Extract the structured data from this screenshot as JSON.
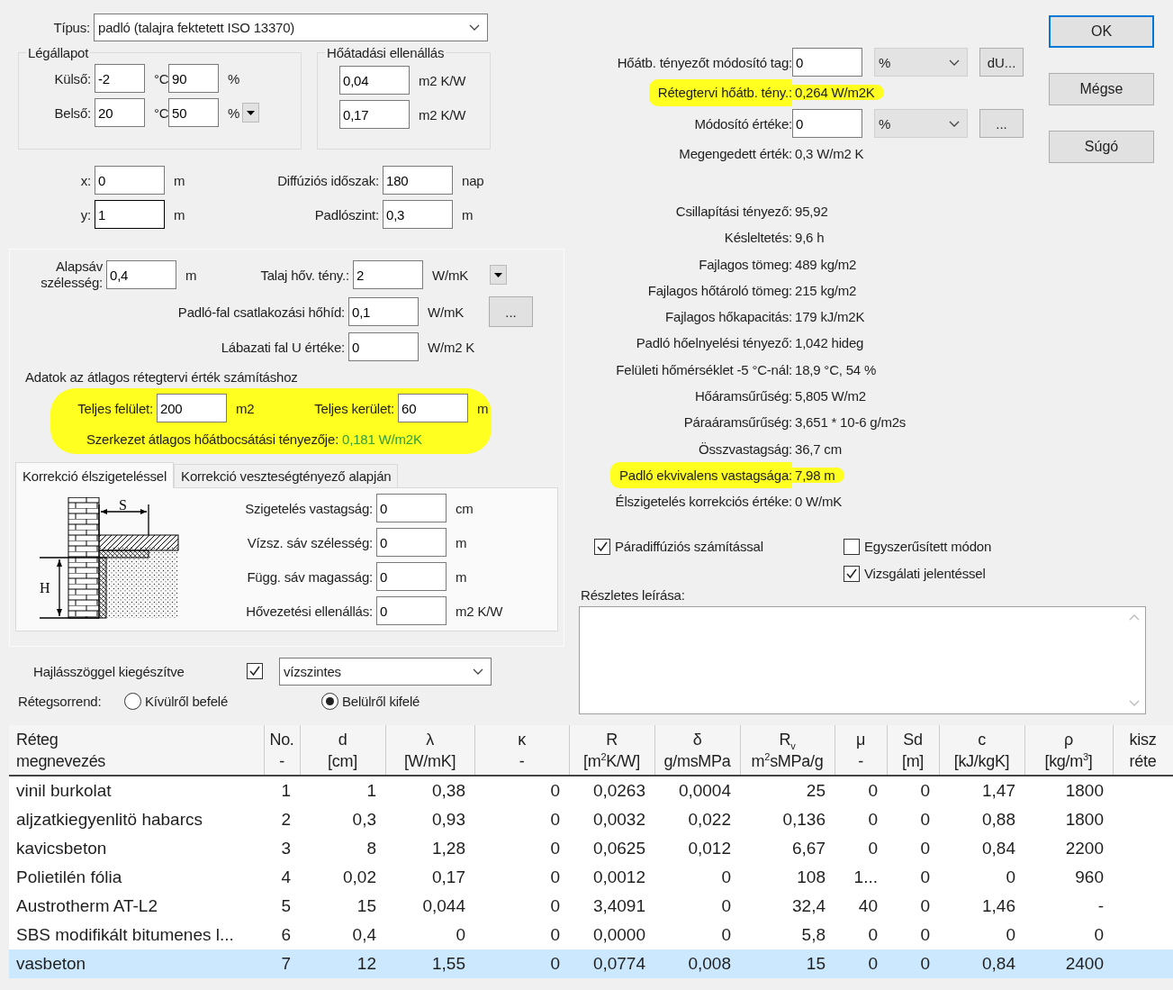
{
  "type_field": {
    "label": "Típus:",
    "value": "padló (talajra fektetett ISO 13370)"
  },
  "air_state": {
    "title": "Légállapot",
    "rows": [
      {
        "label": "Külső:",
        "temp": "-2",
        "temp_unit": "°C",
        "humidity": "90",
        "humidity_unit": "%",
        "dropdown": false
      },
      {
        "label": "Belső:",
        "temp": "20",
        "temp_unit": "°C",
        "humidity": "50",
        "humidity_unit": "%",
        "dropdown": true
      }
    ]
  },
  "surface_resistance": {
    "title": "Hőátadási ellenállás",
    "rows": [
      {
        "value": "0,04",
        "unit": "m2 K/W"
      },
      {
        "value": "0,17",
        "unit": "m2 K/W"
      }
    ]
  },
  "coords": [
    {
      "label": "x:",
      "value": "0",
      "unit": "m",
      "focused": false
    },
    {
      "label": "y:",
      "value": "1",
      "unit": "m",
      "focused": true
    }
  ],
  "diffusion": [
    {
      "label": "Diffúziós időszak:",
      "value": "180",
      "unit": "nap"
    },
    {
      "label": "Padlószint:",
      "value": "0,3",
      "unit": "m"
    }
  ],
  "ground": {
    "base_band": {
      "label": "Alapsáv szélesség:",
      "value": "0,4",
      "unit": "m"
    },
    "fields": [
      {
        "kind": "dropdown",
        "label": "Talaj hőv. tény.:",
        "value": "2",
        "unit": "W/mK"
      },
      {
        "kind": "more",
        "label": "Padló-fal csatlakozási hőhíd:",
        "value": "0,1",
        "unit": "W/mK",
        "button": "..."
      },
      {
        "kind": "plain",
        "label": "Lábazati fal U értéke:",
        "value": "0",
        "unit": "W/m2 K"
      }
    ],
    "average_heading": "Adatok az átlagos rétegtervi érték számításhoz",
    "average": {
      "highlighted": true,
      "area": {
        "label": "Teljes felület:",
        "value": "200",
        "unit": "m2"
      },
      "perimeter": {
        "label": "Teljes kerület:",
        "value": "60",
        "unit": "m"
      },
      "result_label": "Szerkezet átlagos hőátbocsátási tényezője:",
      "result_value": "0,181 W/m2K"
    },
    "tabs": [
      {
        "label": "Korrekció élszigeteléssel",
        "selected": true
      },
      {
        "label": "Korrekció veszteségtényező alapján",
        "selected": false
      }
    ],
    "diagram_labels": [
      "S",
      "H"
    ],
    "edge_fields": [
      {
        "label": "Szigetelés vastagság:",
        "value": "0",
        "unit": "cm"
      },
      {
        "label": "Vízsz. sáv szélesség:",
        "value": "0",
        "unit": "m"
      },
      {
        "label": "Függ. sáv magasság:",
        "value": "0",
        "unit": "m"
      },
      {
        "label": "Hővezetési ellenállás:",
        "value": "0",
        "unit": "m2 K/W"
      }
    ]
  },
  "slope": {
    "label": "Hajlásszöggel kiegészítve",
    "checked": true,
    "value": "vízszintes"
  },
  "layer_order": {
    "label": "Rétegsorrend:",
    "options": [
      {
        "label": "Kívülről befelé",
        "selected": false
      },
      {
        "label": "Belülről kifelé",
        "selected": true
      }
    ]
  },
  "limits": [
    {
      "kind": "input",
      "label": "Hőátb. tényezőt módosító tag:",
      "value": "0",
      "unit": "%",
      "button": "dU...",
      "highlighted": false
    },
    {
      "kind": "text",
      "label": "Rétegtervi hőátb. tény.:",
      "value": "0,264 W/m2K",
      "highlighted": true
    },
    {
      "kind": "input",
      "label": "Módosító értéke:",
      "value": "0",
      "unit": "%",
      "button": "...",
      "highlighted": false
    },
    {
      "kind": "text",
      "label": "Megengedett érték:",
      "value": "0,3 W/m2 K",
      "highlighted": false
    }
  ],
  "results": [
    {
      "label": "Csillapítási tényező:",
      "value": "95,92",
      "highlighted": false
    },
    {
      "label": "Késleltetés:",
      "value": "9,6 h",
      "highlighted": false
    },
    {
      "label": "Fajlagos tömeg:",
      "value": "489 kg/m2",
      "highlighted": false
    },
    {
      "label": "Fajlagos hőtároló tömeg:",
      "value": "215 kg/m2",
      "highlighted": false
    },
    {
      "label": "Fajlagos hőkapacitás:",
      "value": "179 kJ/m2K",
      "highlighted": false
    },
    {
      "label": "Padló hőelnyelési tényező:",
      "value": "1,042 hideg",
      "highlighted": false
    },
    {
      "label": "Felületi hőmérséklet -5 °C-nál:",
      "value": "18,9 °C, 54 %",
      "highlighted": false
    },
    {
      "label": "Hőáramsűrűség:",
      "value": "5,805 W/m2",
      "highlighted": false
    },
    {
      "label": "Páraáramsűrűség:",
      "value": "3,651 * 10-6 g/m2s",
      "highlighted": false
    },
    {
      "label": "Összvastagság:",
      "value": "36,7 cm",
      "highlighted": false
    },
    {
      "label": "Padló ekvivalens vastagsága:",
      "value": "7,98 m",
      "highlighted": true
    },
    {
      "label": "Élszigetelés korrekciós értéke:",
      "value": "0 W/mK",
      "highlighted": false
    }
  ],
  "options": [
    {
      "label": "Páradiffúziós számítással",
      "checked": true
    },
    {
      "label": "Egyszerűsített módon",
      "checked": false
    },
    {
      "label": "Vizsgálati jelentéssel",
      "checked": true
    }
  ],
  "description": {
    "label": "Részletes leírása:"
  },
  "buttons": [
    {
      "label": "OK",
      "default": true
    },
    {
      "label": "Mégse",
      "default": false
    },
    {
      "label": "Súgó",
      "default": false
    }
  ],
  "table": {
    "columns": [
      {
        "line1": "Réteg",
        "line2": "megnevezés"
      },
      {
        "line1": "No.",
        "line2": "-"
      },
      {
        "line1": "d",
        "line2": "[cm]"
      },
      {
        "line1": "λ",
        "line2": "[W/mK]"
      },
      {
        "line1": "κ",
        "line2": "-"
      },
      {
        "line1": "R",
        "line2": "[m$^{2}$K/W]"
      },
      {
        "line1": "δ",
        "line2": "g/msMPa"
      },
      {
        "line1": "R$_{v}$",
        "line2": "m$^{2}$sMPa/g"
      },
      {
        "line1": "μ",
        "line2": "-"
      },
      {
        "line1": "Sd",
        "line2": "[m]"
      },
      {
        "line1": "c",
        "line2": "[kJ/kgK]"
      },
      {
        "line1": "ρ",
        "line2": "[kg/m$^{3}$]"
      },
      {
        "line1": "kisz",
        "line2": "réte"
      }
    ],
    "rows": [
      {
        "selected": false,
        "cells": [
          "vinil burkolat",
          "1",
          "1",
          "0,38",
          "0",
          "0,0263",
          "0,0004",
          "25",
          "0",
          "0",
          "1,47",
          "1800"
        ]
      },
      {
        "selected": false,
        "cells": [
          "aljzatkiegyenlitö habarcs",
          "2",
          "0,3",
          "0,93",
          "0",
          "0,0032",
          "0,022",
          "0,136",
          "0",
          "0",
          "0,88",
          "1800"
        ]
      },
      {
        "selected": false,
        "cells": [
          "kavicsbeton",
          "3",
          "8",
          "1,28",
          "0",
          "0,0625",
          "0,012",
          "6,67",
          "0",
          "0",
          "0,84",
          "2200"
        ]
      },
      {
        "selected": false,
        "cells": [
          "Polietilén fólia",
          "4",
          "0,02",
          "0,17",
          "0",
          "0,0012",
          "0",
          "108",
          "1...",
          "0",
          "0",
          "960"
        ]
      },
      {
        "selected": false,
        "cells": [
          "Austrotherm AT-L2",
          "5",
          "15",
          "0,044",
          "0",
          "3,4091",
          "0",
          "32,4",
          "40",
          "0",
          "1,46",
          "-"
        ]
      },
      {
        "selected": false,
        "cells": [
          "SBS modifikált bitumenes l...",
          "6",
          "0,4",
          "0",
          "0",
          "0,0000",
          "0",
          "5,8",
          "0",
          "0",
          "0",
          "0"
        ]
      },
      {
        "selected": true,
        "cells": [
          "vasbeton",
          "7",
          "12",
          "1,55",
          "0",
          "0,0774",
          "0,008",
          "15",
          "0",
          "0",
          "0,84",
          "2400"
        ]
      }
    ]
  }
}
